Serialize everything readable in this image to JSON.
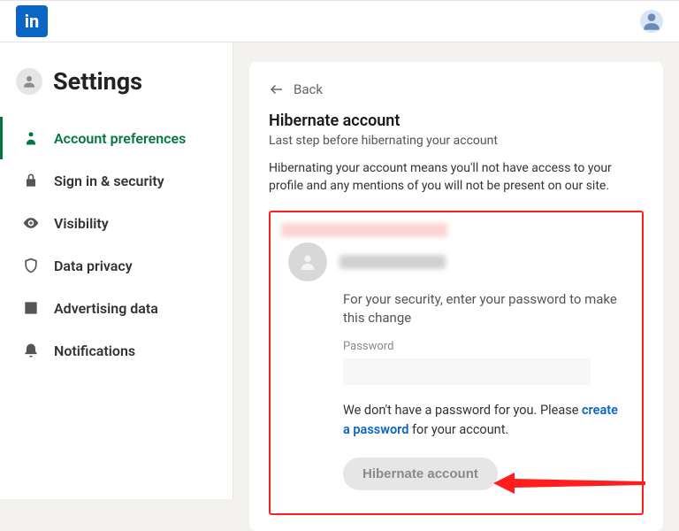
{
  "app": {
    "logo_text": "in"
  },
  "sidebar": {
    "title": "Settings",
    "items": [
      {
        "label": "Account preferences"
      },
      {
        "label": "Sign in & security"
      },
      {
        "label": "Visibility"
      },
      {
        "label": "Data privacy"
      },
      {
        "label": "Advertising data"
      },
      {
        "label": "Notifications"
      }
    ]
  },
  "page": {
    "back_label": "Back",
    "heading": "Hibernate account",
    "subtitle": "Last step before hibernating your account",
    "description": "Hibernating your account means you'll not have access to your profile and any mentions of you will not be present on our site.",
    "security_text": "For your security, enter your password to make this change",
    "password_label": "Password",
    "no_password_pre": "We don't have a password for you. Please ",
    "create_pw_link": "create a password",
    "no_password_post": " for your account.",
    "button_label": "Hibernate account"
  }
}
